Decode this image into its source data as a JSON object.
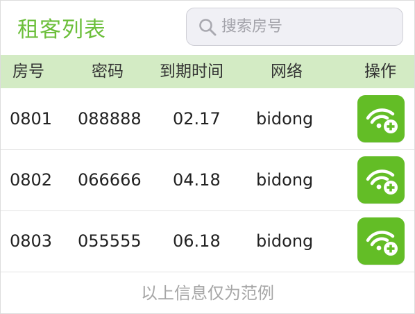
{
  "header": {
    "title": "租客列表",
    "search": {
      "placeholder": "搜索房号",
      "value": "",
      "icon": "search-icon"
    }
  },
  "table": {
    "columns": [
      "房号",
      "密码",
      "到期时间",
      "网络",
      "操作"
    ],
    "rows": [
      {
        "room": "0801",
        "password": "088888",
        "expires": "02.17",
        "network": "bidong",
        "action_icon": "wifi-add-icon"
      },
      {
        "room": "0802",
        "password": "066666",
        "expires": "04.18",
        "network": "bidong",
        "action_icon": "wifi-add-icon"
      },
      {
        "room": "0803",
        "password": "055555",
        "expires": "06.18",
        "network": "bidong",
        "action_icon": "wifi-add-icon"
      }
    ]
  },
  "footer": {
    "note": "以上信息仅为范例"
  },
  "colors": {
    "accent": "#6cbf3b",
    "header_bg": "#d3ebc4",
    "button_bg": "#63bd26",
    "search_bg": "#f0f0f5",
    "footer_text": "#a6a6a6"
  }
}
